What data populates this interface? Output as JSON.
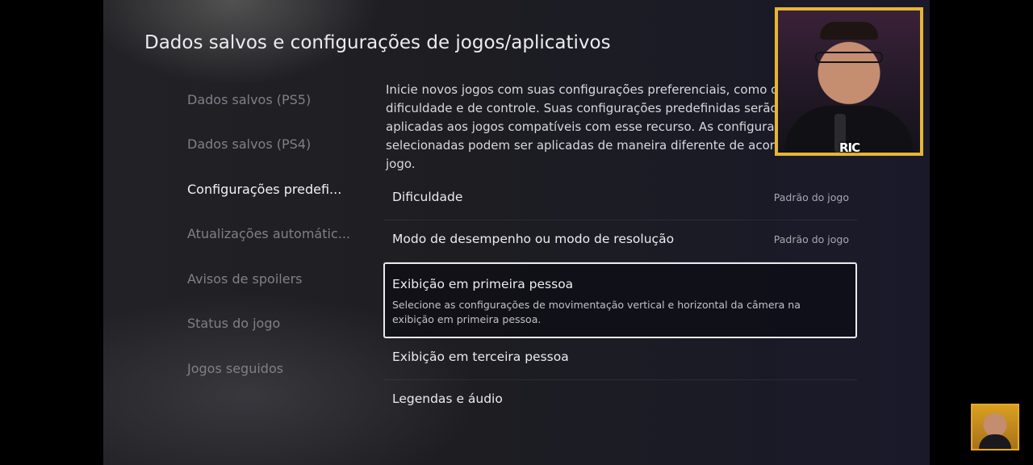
{
  "header": {
    "title": "Dados salvos e configurações de jogos/aplicativos"
  },
  "sidebar": {
    "items": [
      {
        "label": "Dados salvos (PS5)"
      },
      {
        "label": "Dados salvos (PS4)"
      },
      {
        "label": "Configurações predefi..."
      },
      {
        "label": "Atualizações automátic..."
      },
      {
        "label": "Avisos de spoilers"
      },
      {
        "label": "Status do jogo"
      },
      {
        "label": "Jogos seguidos"
      }
    ],
    "active_index": 2
  },
  "main": {
    "intro": "Inicie novos jogos com suas configurações preferenciais, como opções de dificuldade e de controle. Suas configurações predefinidas serão aplicadas aos jogos compatíveis com esse recurso. As configurações selecionadas podem ser aplicadas de maneira diferente de acordo com o jogo.",
    "settings": [
      {
        "label": "Dificuldade",
        "value": "Padrão do jogo"
      },
      {
        "label": "Modo de desempenho ou modo de resolução",
        "value": "Padrão do jogo"
      },
      {
        "label": "Exibição em primeira pessoa",
        "description": "Selecione as configurações de movimentação vertical e horizontal da câmera na exibição em primeira pessoa."
      },
      {
        "label": "Exibição em terceira pessoa"
      },
      {
        "label": "Legendas e áudio"
      }
    ],
    "focused_index": 2
  },
  "overlay": {
    "webcam_tag": "RIC",
    "frame_color": "#e8b534"
  }
}
